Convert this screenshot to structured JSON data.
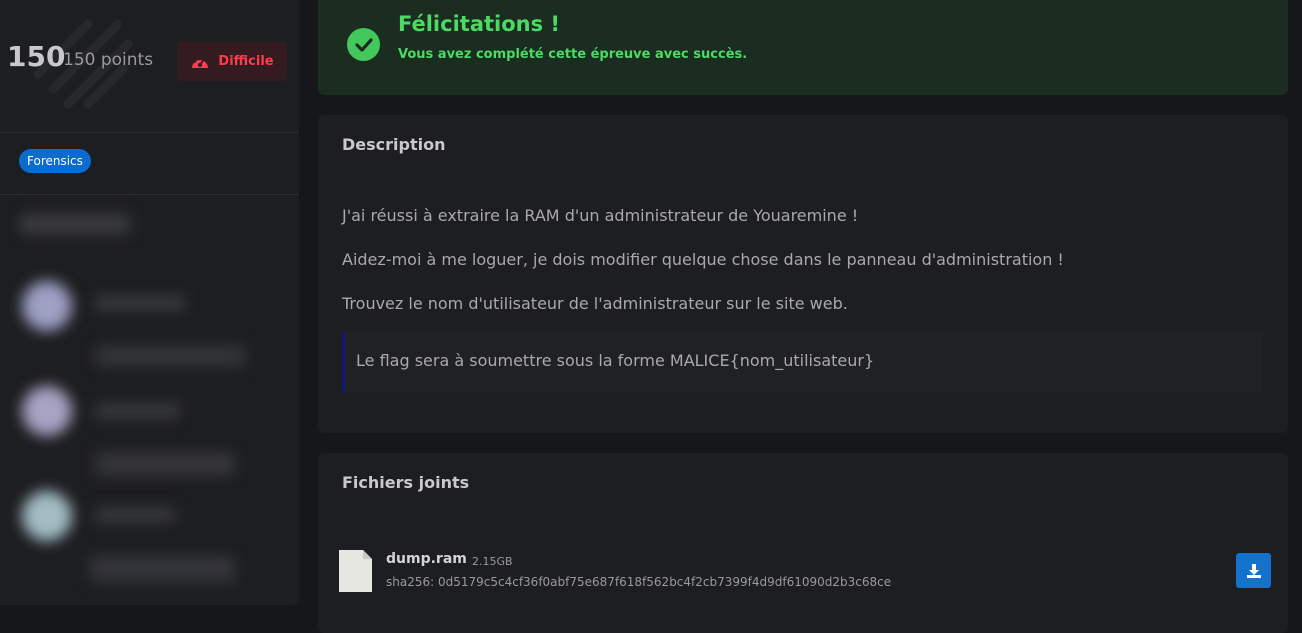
{
  "sidebar": {
    "points_value": "150",
    "points_label": "150 points",
    "difficulty": "Difficile",
    "tags": [
      "Forensics"
    ]
  },
  "success": {
    "title": "Félicitations !",
    "message": "Vous avez complété cette épreuve avec succès."
  },
  "description": {
    "title": "Description",
    "paragraphs": [
      "J'ai réussi à extraire la RAM d'un administrateur de Youaremine !",
      "Aidez-moi à me loguer, je dois modifier quelque chose dans le panneau d'administration !",
      "Trouvez le nom d'utilisateur de l'administrateur sur le site web."
    ],
    "note": "Le flag sera à soumettre sous la forme MALICE{nom_utilisateur}"
  },
  "attachments": {
    "title": "Fichiers joints",
    "files": [
      {
        "name": "dump.ram",
        "size": "2.15GB",
        "hash": "sha256: 0d5179c5c4cf36f0abf75e687f618f562bc4f2cb7399f4d9df61090d2b3c68ce"
      }
    ]
  },
  "colors": {
    "success": "#4cd964",
    "danger": "#ff3b4e",
    "primary": "#1272cc",
    "tag": "#0b6bcf"
  },
  "icons": {
    "success": "check-circle-icon",
    "difficulty": "speedometer-icon",
    "file": "file-icon",
    "download": "download-icon"
  }
}
